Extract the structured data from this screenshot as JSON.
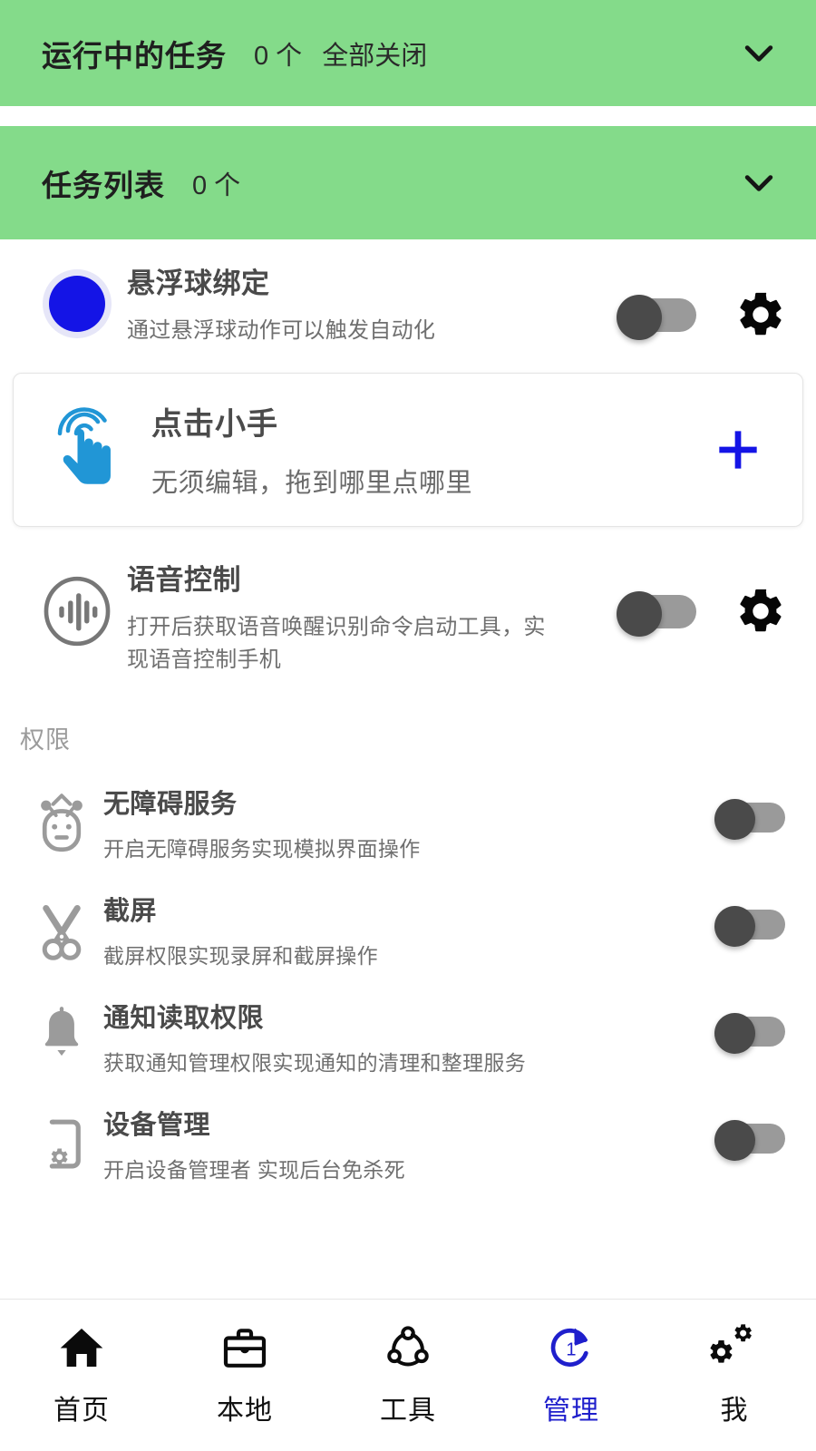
{
  "theme": {
    "green": "#84db8a",
    "accent_blue": "#1f1fcc",
    "dot_blue": "#1414e6",
    "hand_blue": "#2196d6",
    "toggle_off_thumb": "#4a4a4a",
    "toggle_off_track": "#9a9a9a",
    "title_gray": "#4a4a4a",
    "desc_gray": "#6f6f6f"
  },
  "headers": [
    {
      "title": "运行中的任务",
      "count": "0 个",
      "action": "全部关闭",
      "chevron": "chevron-down-icon"
    },
    {
      "title": "任务列表",
      "count": "0 个",
      "action": "",
      "chevron": "chevron-down-icon"
    }
  ],
  "features": [
    {
      "icon": "blue-dot-icon",
      "title": "悬浮球绑定",
      "desc": "通过悬浮球动作可以触发自动化",
      "toggle": "off",
      "gear": "gear-icon"
    },
    {
      "icon": "voice-wave-icon",
      "title": "语音控制",
      "desc": "打开后获取语音唤醒识别命令启动工具，实现语音控制手机",
      "toggle": "off",
      "gear": "gear-icon"
    }
  ],
  "highlight_card": {
    "icon": "tap-hand-icon",
    "title": "点击小手",
    "desc": "无须编辑，拖到哪里点哪里",
    "action_icon": "plus-icon"
  },
  "permissions_section": {
    "label": "权限",
    "items": [
      {
        "icon": "accessibility-robot-icon",
        "title": "无障碍服务",
        "desc": "开启无障碍服务实现模拟界面操作",
        "toggle": "off"
      },
      {
        "icon": "scissors-icon",
        "title": "截屏",
        "desc": "截屏权限实现录屏和截屏操作",
        "toggle": "off"
      },
      {
        "icon": "bell-icon",
        "title": "通知读取权限",
        "desc": "获取通知管理权限实现通知的清理和整理服务",
        "toggle": "off"
      },
      {
        "icon": "device-gear-icon",
        "title": "设备管理",
        "desc": "开启设备管理者 实现后台免杀死",
        "toggle": "off"
      }
    ]
  },
  "bottom_nav": {
    "items": [
      {
        "icon": "home-icon",
        "label": "首页",
        "active": false
      },
      {
        "icon": "briefcase-icon",
        "label": "本地",
        "active": false
      },
      {
        "icon": "share-nodes-icon",
        "label": "工具",
        "active": false
      },
      {
        "icon": "refresh-badge-icon",
        "label": "管理",
        "active": true
      },
      {
        "icon": "gears-icon",
        "label": "我",
        "active": false
      }
    ]
  }
}
